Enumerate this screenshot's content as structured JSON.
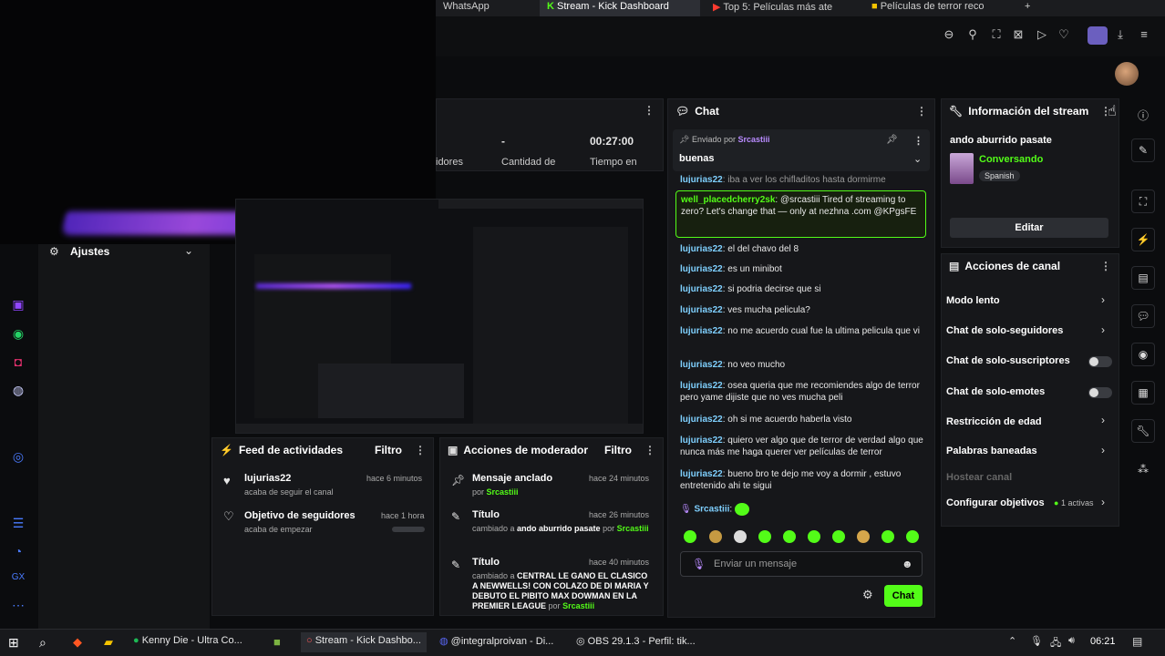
{
  "browser": {
    "tabs": [
      {
        "label": "WhatsApp",
        "active": false
      },
      {
        "label": "Stream - Kick Dashboard",
        "active": true
      },
      {
        "label": "Top 5: Películas más ate",
        "active": false
      },
      {
        "label": "Películas de terror reco",
        "active": false
      }
    ],
    "new_tab_symbol": "+"
  },
  "left_nav": {
    "settings_label": "Ajustes"
  },
  "stats": {
    "viewers_value": "-",
    "viewers_label": "Cantidad de",
    "followers_partial_label": "idores",
    "time_value": "00:27:00",
    "time_label": "Tiempo en"
  },
  "chat": {
    "title": "Chat",
    "pinned_label": "Enviado por",
    "pinned_user": "Srcastiii",
    "pinned_message": "buenas",
    "messages": [
      {
        "user": "lujurias22",
        "text": "iba a ver los chifladitos hasta dormirme"
      },
      {
        "user": "well_placedcherry2sk",
        "text": "@srcastiii Tired of streaming to zero? Let's change that — only at nezhna .com @KPgsFE"
      },
      {
        "user": "lujurias22",
        "text": "el del chavo del 8"
      },
      {
        "user": "lujurias22",
        "text": "es un minibot"
      },
      {
        "user": "lujurias22",
        "text": "si podria decirse que si"
      },
      {
        "user": "lujurias22",
        "text": "ves mucha pelicula?"
      },
      {
        "user": "lujurias22",
        "text": "no me acuerdo cual fue la ultima pelicula que vi"
      },
      {
        "user": "lujurias22",
        "text": "no veo mucho"
      },
      {
        "user": "lujurias22",
        "text": "osea queria que me recomiendes algo de terror pero yame dijiste que no ves mucha peli"
      },
      {
        "user": "lujurias22",
        "text": "oh si me acuerdo haberla visto"
      },
      {
        "user": "lujurias22",
        "text": "quiero ver algo que de terror de verdad algo que nunca más me haga querer ver películas de terror"
      },
      {
        "user": "lujurias22",
        "text": "bueno bro te dejo me voy a dormir , estuvo entretenido ahi te sigui"
      },
      {
        "user": "Srcastiii",
        "text": ""
      }
    ],
    "input_placeholder": "Enviar un mensaje",
    "send_label": "Chat"
  },
  "stream_info": {
    "title": "Información del stream",
    "stream_title": "ando aburrido pasate",
    "category": "Conversando",
    "language": "Spanish",
    "edit_label": "Editar"
  },
  "channel_actions": {
    "title": "Acciones de canal",
    "items": [
      {
        "label": "Modo lento",
        "type": "chevron"
      },
      {
        "label": "Chat de solo-seguidores",
        "type": "chevron"
      },
      {
        "label": "Chat de solo-suscriptores",
        "type": "toggle"
      },
      {
        "label": "Chat de solo-emotes",
        "type": "toggle"
      },
      {
        "label": "Restricción de edad",
        "type": "chevron"
      },
      {
        "label": "Palabras baneadas",
        "type": "chevron"
      },
      {
        "label": "Hostear canal",
        "type": "disabled"
      },
      {
        "label": "Configurar objetivos",
        "type": "chevron"
      }
    ],
    "goals_active": "1 activas"
  },
  "activity_feed": {
    "title": "Feed de actividades",
    "filter_label": "Filtro",
    "items": [
      {
        "title": "lujurias22",
        "subtitle": "acaba de seguir el canal",
        "time": "hace 6 minutos"
      },
      {
        "title": "Objetivo de seguidores",
        "subtitle": "acaba de empezar",
        "time": "hace 1 hora"
      }
    ]
  },
  "mod_actions": {
    "title": "Acciones de moderador",
    "filter_label": "Filtro",
    "items": [
      {
        "title": "Mensaje anclado",
        "by_label": "por",
        "by_user": "Srcastiii",
        "time": "hace 24 minutos"
      },
      {
        "title": "Título",
        "changed_label": "cambiado a",
        "value": "ando aburrido pasate",
        "by_label": "por",
        "by_user": "Srcastiii",
        "time": "hace 26 minutos"
      },
      {
        "title": "Título",
        "changed_label": "cambiado a",
        "value": "CENTRAL LE GANO EL CLASICO A NEWWELLS! CON COLAZO DE DI MARIA Y DEBUTO EL PIBITO MAX DOWMAN EN LA PREMIER LEAGUE",
        "by_label": "por",
        "by_user": "Srcastiii",
        "time": "hace 40 minutos"
      }
    ]
  },
  "taskbar": {
    "items": [
      {
        "label": "Kenny Die - Ultra Co..."
      },
      {
        "label": "Stream - Kick Dashbo..."
      },
      {
        "label": "@integralproivan - Di..."
      },
      {
        "label": "OBS 29.1.3 - Perfil: tik..."
      }
    ],
    "clock": "06:21"
  },
  "colors": {
    "accent": "#53fc18",
    "username": "#7fd0ff",
    "panel": "#16171a"
  }
}
